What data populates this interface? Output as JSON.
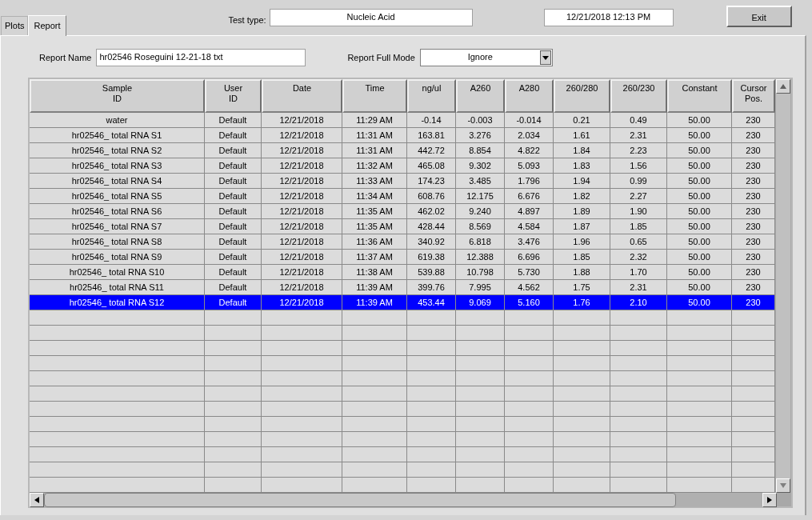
{
  "tabs": [
    {
      "label": "Plots",
      "selected": false
    },
    {
      "label": "Report",
      "selected": true
    }
  ],
  "test_type": {
    "label": "Test type:",
    "value": "Nucleic Acid"
  },
  "datetime": "12/21/2018  12:13 PM",
  "exit_button": "Exit",
  "report_name": {
    "label": "Report Name",
    "value": "hr02546 Roseguini 12-21-18 txt"
  },
  "report_full_mode": {
    "label": "Report Full Mode",
    "value": "Ignore"
  },
  "table": {
    "columns": [
      "Sample\nID",
      "User\nID",
      "Date",
      "Time",
      "ng/ul",
      "A260",
      "A280",
      "260/280",
      "260/230",
      "Constant",
      "Cursor\nPos."
    ],
    "rows": [
      {
        "selected": false,
        "cells": [
          "water",
          "Default",
          "12/21/2018",
          "11:29 AM",
          "-0.14",
          "-0.003",
          "-0.014",
          "0.21",
          "0.49",
          "50.00",
          "230"
        ]
      },
      {
        "selected": false,
        "cells": [
          "hr02546_ total RNA S1",
          "Default",
          "12/21/2018",
          "11:31 AM",
          "163.81",
          "3.276",
          "2.034",
          "1.61",
          "2.31",
          "50.00",
          "230"
        ]
      },
      {
        "selected": false,
        "cells": [
          "hr02546_ total RNA S2",
          "Default",
          "12/21/2018",
          "11:31 AM",
          "442.72",
          "8.854",
          "4.822",
          "1.84",
          "2.23",
          "50.00",
          "230"
        ]
      },
      {
        "selected": false,
        "cells": [
          "hr02546_ total RNA S3",
          "Default",
          "12/21/2018",
          "11:32 AM",
          "465.08",
          "9.302",
          "5.093",
          "1.83",
          "1.56",
          "50.00",
          "230"
        ]
      },
      {
        "selected": false,
        "cells": [
          "hr02546_ total RNA S4",
          "Default",
          "12/21/2018",
          "11:33 AM",
          "174.23",
          "3.485",
          "1.796",
          "1.94",
          "0.99",
          "50.00",
          "230"
        ]
      },
      {
        "selected": false,
        "cells": [
          "hr02546_ total RNA S5",
          "Default",
          "12/21/2018",
          "11:34 AM",
          "608.76",
          "12.175",
          "6.676",
          "1.82",
          "2.27",
          "50.00",
          "230"
        ]
      },
      {
        "selected": false,
        "cells": [
          "hr02546_ total RNA S6",
          "Default",
          "12/21/2018",
          "11:35 AM",
          "462.02",
          "9.240",
          "4.897",
          "1.89",
          "1.90",
          "50.00",
          "230"
        ]
      },
      {
        "selected": false,
        "cells": [
          "hr02546_ total RNA S7",
          "Default",
          "12/21/2018",
          "11:35 AM",
          "428.44",
          "8.569",
          "4.584",
          "1.87",
          "1.85",
          "50.00",
          "230"
        ]
      },
      {
        "selected": false,
        "cells": [
          "hr02546_ total RNA S8",
          "Default",
          "12/21/2018",
          "11:36 AM",
          "340.92",
          "6.818",
          "3.476",
          "1.96",
          "0.65",
          "50.00",
          "230"
        ]
      },
      {
        "selected": false,
        "cells": [
          "hr02546_ total RNA S9",
          "Default",
          "12/21/2018",
          "11:37 AM",
          "619.38",
          "12.388",
          "6.696",
          "1.85",
          "2.32",
          "50.00",
          "230"
        ]
      },
      {
        "selected": false,
        "cells": [
          "hr02546_ total RNA S10",
          "Default",
          "12/21/2018",
          "11:38 AM",
          "539.88",
          "10.798",
          "5.730",
          "1.88",
          "1.70",
          "50.00",
          "230"
        ]
      },
      {
        "selected": false,
        "cells": [
          "hr02546_ total RNA S11",
          "Default",
          "12/21/2018",
          "11:39 AM",
          "399.76",
          "7.995",
          "4.562",
          "1.75",
          "2.31",
          "50.00",
          "230"
        ]
      },
      {
        "selected": true,
        "cells": [
          "hr02546_ total RNA S12",
          "Default",
          "12/21/2018",
          "11:39 AM",
          "453.44",
          "9.069",
          "5.160",
          "1.76",
          "2.10",
          "50.00",
          "230"
        ]
      }
    ]
  }
}
